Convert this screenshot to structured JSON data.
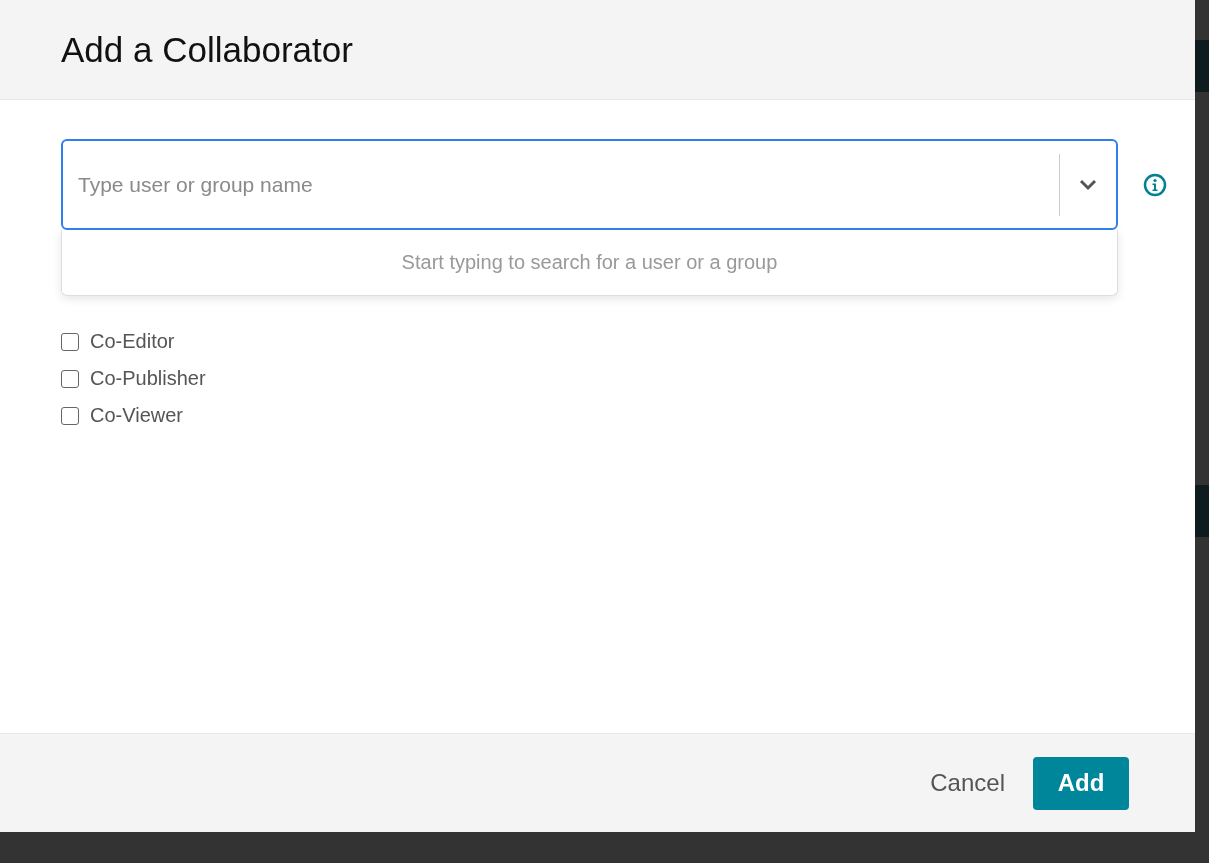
{
  "dialog": {
    "title": "Add a Collaborator"
  },
  "search": {
    "placeholder": "Type user or group name",
    "focused": true,
    "expanded": true
  },
  "dropdown": {
    "message": "Start typing to search for a user or a group"
  },
  "roles": [
    {
      "label": "Co-Editor",
      "checked": false
    },
    {
      "label": "Co-Publisher",
      "checked": false
    },
    {
      "label": "Co-Viewer",
      "checked": false
    }
  ],
  "buttons": [
    {
      "label": "Cancel",
      "kind": "secondary"
    },
    {
      "label": "Add",
      "kind": "primary"
    }
  ]
}
